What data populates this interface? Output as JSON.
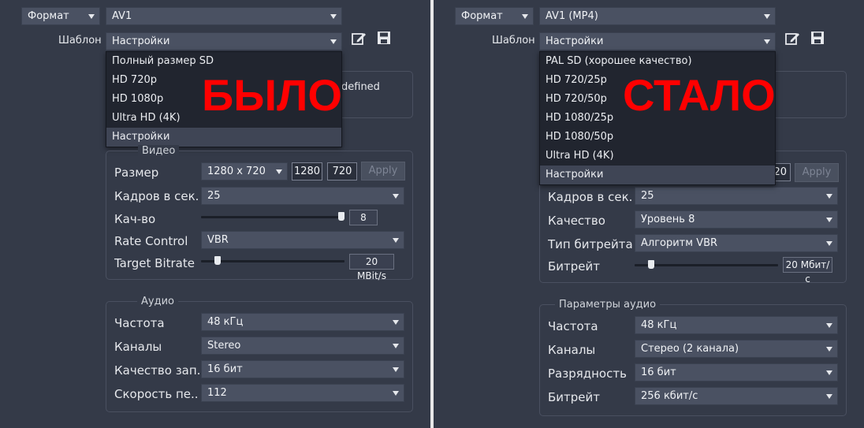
{
  "left": {
    "format_label": "Формат",
    "format_value": "AV1",
    "template_label": "Шаблон",
    "template_value": "Настройки",
    "dropdown_items": [
      "Полный размер SD",
      "HD 720p",
      "HD 1080p",
      "Ultra HD (4K)",
      "Настройки"
    ],
    "selected_index": 4,
    "stamp": "БЫЛО",
    "hidden_text": "defined",
    "video_group": "Видео",
    "size_label": "Размер",
    "size_value": "1280 x 720",
    "width": "1280",
    "height": "720",
    "apply": "Apply",
    "fps_label": "Кадров в сек.",
    "fps_value": "25",
    "quality_label": "Кач-во",
    "quality_value": "8",
    "quality_fraction": 1.0,
    "rate_label": "Rate Control",
    "rate_value": "VBR",
    "bitrate_label": "Target Bitrate",
    "bitrate_value": "20 MBit/s",
    "bitrate_fraction": 0.1,
    "audio_group": "Аудио",
    "freq_label": "Частота",
    "freq_value": "48 кГц",
    "channels_label": "Каналы",
    "channels_value": "Stereo",
    "sample_label": "Качество зап...",
    "sample_value": "16 бит",
    "speed_label": "Скорость пе...",
    "speed_value": "112"
  },
  "right": {
    "format_label": "Формат",
    "format_value": "AV1 (MP4)",
    "template_label": "Шаблон",
    "template_value": "Настройки",
    "dropdown_items": [
      "PAL SD (хорошее качество)",
      "HD 720/25p",
      "HD 720/50p",
      "HD 1080/25p",
      "HD 1080/50p",
      "Ultra HD (4K)",
      "Настройки"
    ],
    "selected_index": 6,
    "stamp": "СТАЛО",
    "height_partial": "20",
    "apply": "Apply",
    "fps_label": "Кадров в сек.",
    "fps_value": "25",
    "quality_label": "Качество",
    "quality_value": "Уровень 8",
    "rate_label": "Тип битрейта",
    "rate_value": "Алгоритм VBR",
    "bitrate_label": "Битрейт",
    "bitrate_value": "20 Мбит/с",
    "bitrate_fraction": 0.1,
    "audio_group": "Параметры аудио",
    "freq_label": "Частота",
    "freq_value": "48 кГц",
    "channels_label": "Каналы",
    "channels_value": "Стерео (2 канала)",
    "depth_label": "Разрядность",
    "depth_value": "16 бит",
    "abitrate_label": "Битрейт",
    "abitrate_value": "256 кбит/с"
  },
  "icons": {
    "edit": "edit-icon",
    "save": "save-icon"
  },
  "colors": {
    "stamp": "#ff0000",
    "background": "#343a48",
    "divider": "#e8e8e8"
  }
}
